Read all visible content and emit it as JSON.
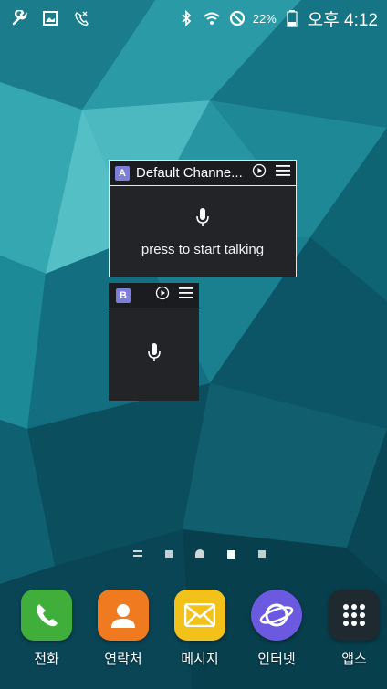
{
  "status_bar": {
    "battery_percent": "22%",
    "time": "오후 4:12",
    "left_icons": [
      "wrench-icon",
      "gallery-icon",
      "missed-call-icon"
    ],
    "right_icons": [
      "bluetooth-icon",
      "wifi-icon",
      "do-not-disturb-icon",
      "battery-icon"
    ]
  },
  "widget_a": {
    "badge": "A",
    "channel_name": "Default Channe...",
    "talk_hint": "press to start talking"
  },
  "widget_b": {
    "badge": "B"
  },
  "pager": {
    "pages": 5,
    "active_index": 3
  },
  "dock": {
    "apps": [
      {
        "label": "전화",
        "icon": "phone-icon",
        "color": "#3fae3a"
      },
      {
        "label": "연락처",
        "icon": "contacts-icon",
        "color": "#f07a1f"
      },
      {
        "label": "메시지",
        "icon": "messages-icon",
        "color": "#f3c21a"
      },
      {
        "label": "인터넷",
        "icon": "internet-icon",
        "color": "#6b5ae0"
      },
      {
        "label": "앱스",
        "icon": "apps-grid-icon",
        "color": "#1f2a30"
      }
    ]
  },
  "colors": {
    "wallpaper_base": "#0f5c6e",
    "widget_bg": "#222427",
    "badge": "#7b7fd9"
  }
}
